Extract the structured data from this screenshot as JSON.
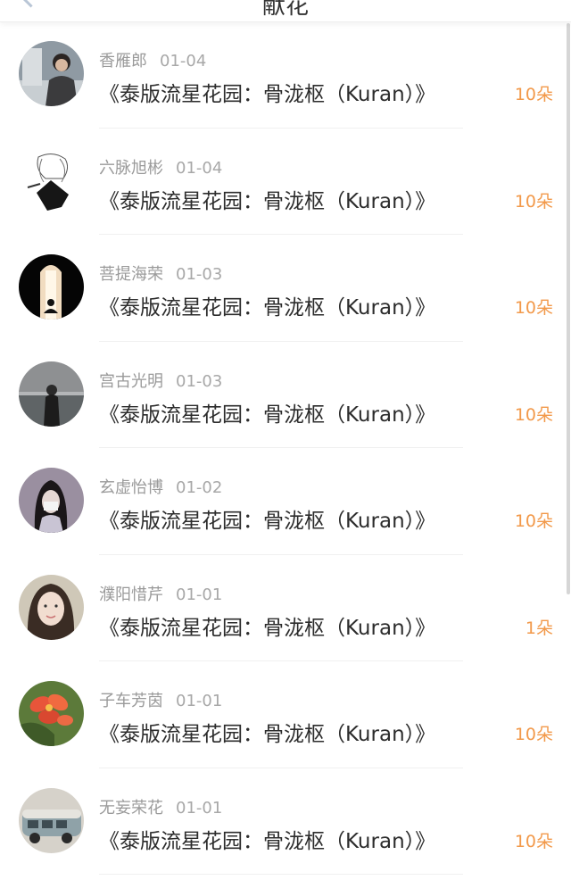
{
  "header": {
    "title": "献花",
    "back_icon": "chevron-left-icon"
  },
  "colors": {
    "count": "#f2994a",
    "name": "#9a9a9a",
    "title": "#2c2c2c"
  },
  "list": [
    {
      "name": "香雁郎",
      "date": "01-04",
      "title": "《泰版流星花园：骨泷枢（Kuran）》",
      "count": "10朵",
      "avatar": "avatar-photo"
    },
    {
      "name": "六脉旭彬",
      "date": "01-04",
      "title": "《泰版流星花园：骨泷枢（Kuran）》",
      "count": "10朵",
      "avatar": "avatar-photo"
    },
    {
      "name": "菩提海荣",
      "date": "01-03",
      "title": "《泰版流星花园：骨泷枢（Kuran）》",
      "count": "10朵",
      "avatar": "avatar-photo"
    },
    {
      "name": "宫古光明",
      "date": "01-03",
      "title": "《泰版流星花园：骨泷枢（Kuran）》",
      "count": "10朵",
      "avatar": "avatar-photo"
    },
    {
      "name": "玄虚怡博",
      "date": "01-02",
      "title": "《泰版流星花园：骨泷枢（Kuran）》",
      "count": "10朵",
      "avatar": "avatar-photo"
    },
    {
      "name": "濮阳惜芹",
      "date": "01-01",
      "title": "《泰版流星花园：骨泷枢（Kuran）》",
      "count": "1朵",
      "avatar": "avatar-photo"
    },
    {
      "name": "子车芳茵",
      "date": "01-01",
      "title": "《泰版流星花园：骨泷枢（Kuran）》",
      "count": "10朵",
      "avatar": "avatar-photo"
    },
    {
      "name": "无妄荣花",
      "date": "01-01",
      "title": "《泰版流星花园：骨泷枢（Kuran）》",
      "count": "10朵",
      "avatar": "avatar-photo"
    }
  ]
}
